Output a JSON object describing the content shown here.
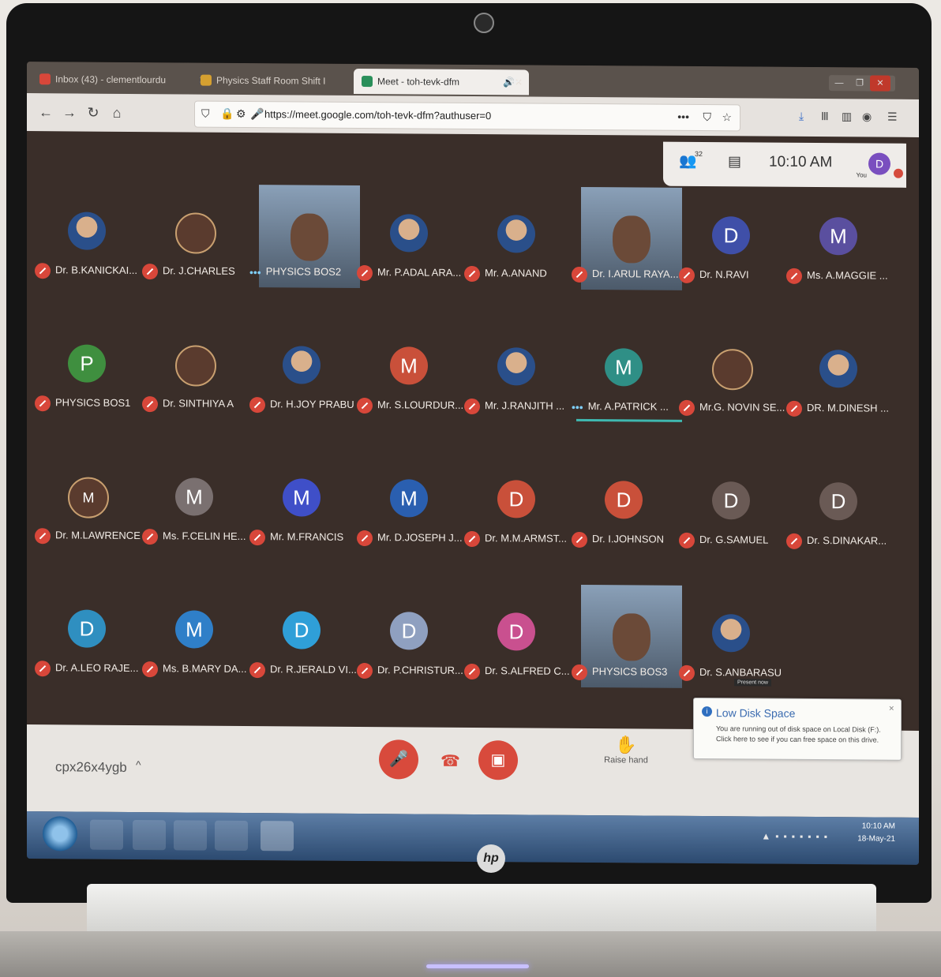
{
  "browser": {
    "tabs": [
      {
        "label": "Inbox (43) - clementlourdu",
        "icon": "mail-icon",
        "color": "#d8473a",
        "active": false
      },
      {
        "label": "Physics Staff Room Shift I",
        "icon": "classroom-icon",
        "color": "#d5a030",
        "active": false
      },
      {
        "label": "Meet - toh-tevk-dfm",
        "icon": "meet-icon",
        "color": "#2a8f5a",
        "active": true
      }
    ],
    "new_tab": "+",
    "url": "https://meet.google.com/toh-tevk-dfm?authuser=0"
  },
  "meet": {
    "participant_count": "32",
    "time": "10:10 AM",
    "you_label": "You",
    "my_avatar": "D",
    "participants": [
      {
        "name": "Dr. B.KANICKAI...",
        "avatar": "",
        "type": "photo",
        "status": "muted"
      },
      {
        "name": "Dr. J.CHARLES",
        "avatar": "",
        "type": "logo",
        "status": "muted"
      },
      {
        "name": "PHYSICS BOS2",
        "avatar": "",
        "type": "video",
        "status": "speaking"
      },
      {
        "name": "Mr. P.ADAL ARA...",
        "avatar": "",
        "type": "photo",
        "status": "muted"
      },
      {
        "name": "Mr. A.ANAND",
        "avatar": "",
        "type": "photo",
        "status": "muted"
      },
      {
        "name": "Dr. I.ARUL RAYA...",
        "avatar": "",
        "type": "video",
        "status": "muted"
      },
      {
        "name": "Dr. N.RAVI",
        "avatar": "D",
        "type": "letter",
        "color": "#3f4fa8",
        "status": "muted"
      },
      {
        "name": "Ms. A.MAGGIE ...",
        "avatar": "M",
        "type": "letter",
        "color": "#5a4f9f",
        "status": "muted"
      },
      {
        "name": "PHYSICS BOS1",
        "avatar": "P",
        "type": "letter",
        "color": "#3f8f3f",
        "status": "muted"
      },
      {
        "name": "Dr. SINTHIYA A",
        "avatar": "",
        "type": "logo",
        "status": "muted"
      },
      {
        "name": "Dr. H.JOY PRABU",
        "avatar": "",
        "type": "photo",
        "status": "muted"
      },
      {
        "name": "Mr. S.LOURDUR...",
        "avatar": "M",
        "type": "letter",
        "color": "#c9503a",
        "status": "muted"
      },
      {
        "name": "Mr. J.RANJITH ...",
        "avatar": "",
        "type": "photo",
        "status": "muted"
      },
      {
        "name": "Mr. A.PATRICK ...",
        "avatar": "M",
        "type": "letter",
        "color": "#2f8f86",
        "status": "speaking"
      },
      {
        "name": "Mr.G. NOVIN SE...",
        "avatar": "",
        "type": "logo",
        "status": "muted"
      },
      {
        "name": "DR. M.DINESH ...",
        "avatar": "",
        "type": "photo",
        "status": "muted"
      },
      {
        "name": "Dr. M.LAWRENCE",
        "avatar": "M",
        "type": "logo",
        "status": "muted"
      },
      {
        "name": "Ms. F.CELIN HE...",
        "avatar": "M",
        "type": "letter",
        "color": "#7a7070",
        "status": "muted"
      },
      {
        "name": "Mr. M.FRANCIS",
        "avatar": "M",
        "type": "letter",
        "color": "#3f4fc8",
        "status": "muted"
      },
      {
        "name": "Mr. D.JOSEPH J...",
        "avatar": "M",
        "type": "letter",
        "color": "#2a5fb0",
        "status": "muted"
      },
      {
        "name": "Dr. M.M.ARMST...",
        "avatar": "D",
        "type": "letter",
        "color": "#c9503a",
        "status": "muted"
      },
      {
        "name": "Dr. I.JOHNSON",
        "avatar": "D",
        "type": "letter",
        "color": "#c9503a",
        "status": "muted"
      },
      {
        "name": "Dr. G.SAMUEL",
        "avatar": "D",
        "type": "letter",
        "color": "#6a5a55",
        "status": "muted"
      },
      {
        "name": "Dr. S.DINAKAR...",
        "avatar": "D",
        "type": "letter",
        "color": "#6a5a55",
        "status": "muted"
      },
      {
        "name": "Dr. A.LEO RAJE...",
        "avatar": "D",
        "type": "letter",
        "color": "#2f8fc0",
        "status": "muted"
      },
      {
        "name": "Ms. B.MARY DA...",
        "avatar": "M",
        "type": "letter",
        "color": "#2f7fc8",
        "status": "muted"
      },
      {
        "name": "Dr. R.JERALD VI...",
        "avatar": "D",
        "type": "letter",
        "color": "#2f9fd8",
        "status": "muted"
      },
      {
        "name": "Dr. P.CHRISTUR...",
        "avatar": "D",
        "type": "letter",
        "color": "#8fa0c0",
        "status": "muted"
      },
      {
        "name": "Dr. S.ALFRED C...",
        "avatar": "D",
        "type": "letter",
        "color": "#c9508f",
        "status": "muted"
      },
      {
        "name": "PHYSICS BOS3",
        "avatar": "",
        "type": "video",
        "status": "muted"
      },
      {
        "name": "Dr. S.ANBARASU",
        "avatar": "",
        "type": "photo",
        "status": "presenting",
        "badge": "Present now"
      }
    ],
    "meeting_code": "cpx26x4ygb",
    "raise_hand_label": "Raise hand"
  },
  "notification": {
    "title": "Low Disk Space",
    "body": "You are running out of disk space on Local Disk (F:). Click here to see if you can free space on this drive."
  },
  "taskbar": {
    "clock_time": "10:10 AM",
    "clock_date": "18-May-21"
  },
  "laptop": {
    "logo": "hp"
  }
}
